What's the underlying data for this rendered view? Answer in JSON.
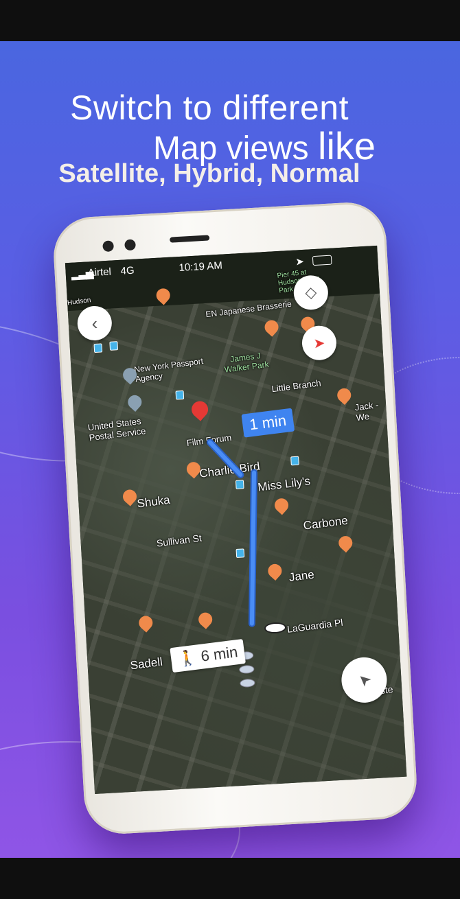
{
  "headline": {
    "line1": "Switch to different",
    "line2": "Map views",
    "line2_bold": "like",
    "line3": "Satellite, Hybrid, Normal"
  },
  "status_bar": {
    "carrier": "Airtel",
    "network": "4G",
    "time": "10:19 AM"
  },
  "map": {
    "labels": {
      "pier": "Pier 45 at Hudson River Park",
      "hudson": "Hudson",
      "restaurant1": "EN Japanese Brasserie",
      "passport": "New York Passport Agency",
      "park": "James J Walker Park",
      "little_branch": "Little Branch",
      "postal": "United States Postal Service",
      "film_forum": "Film Forum",
      "jack": "Jack - We",
      "charlie_bird": "Charlie Bird",
      "miss_lilys": "Miss Lily's",
      "shuka": "Shuka",
      "carbone": "Carbone",
      "sullivan": "Sullivan St",
      "jane": "Jane",
      "laguardia": "LaGuardia Pl",
      "sadell": "Sadell",
      "wooster": "Wooste"
    },
    "route_time": "1 min",
    "walk_time": "6 min"
  },
  "icons": {
    "back": "chevron-left-icon",
    "layers": "layers-icon",
    "compass": "compass-icon",
    "locate": "navigation-arrow-icon",
    "walk": "walking-person-icon"
  },
  "colors": {
    "route": "#4a8df5",
    "pin": "#e53935",
    "poi": "#f08a4b"
  }
}
